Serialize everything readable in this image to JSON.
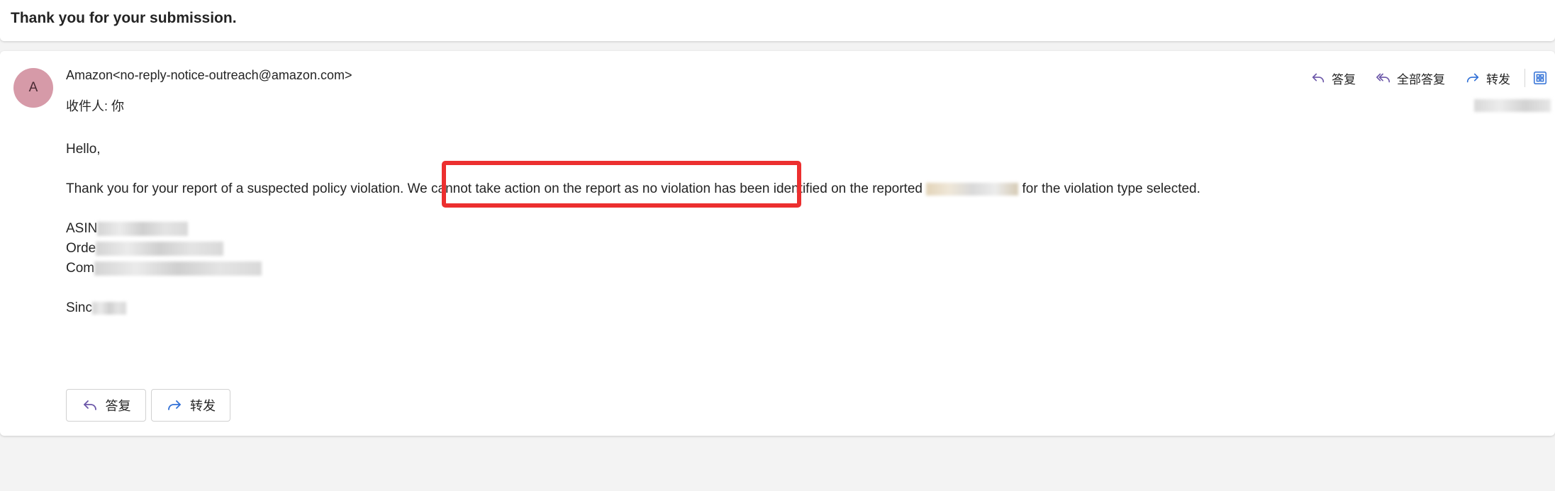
{
  "header": {
    "subject": "Thank you for your submission."
  },
  "message": {
    "avatar_initial": "A",
    "from": "Amazon<no-reply-notice-outreach@amazon.com>",
    "to_label": "收件人:",
    "to_value": "你",
    "actions": {
      "reply": "答复",
      "reply_all": "全部答复",
      "forward": "转发"
    },
    "body": {
      "greeting": "Hello,",
      "line1_pre": "Thank you for your report of a suspected policy violation.",
      "line1_highlight": "We cannot take action on the report as no violation",
      "line1_mid": "has been identified on the reported",
      "line1_post": "for the violation type selected.",
      "asin_prefix": "ASIN",
      "order_prefix": "Orde",
      "comment_prefix": "Com",
      "closing_prefix": "Sinc"
    },
    "footer_buttons": {
      "reply": "答复",
      "forward": "转发"
    }
  },
  "colors": {
    "highlight_border": "#ec2f2f",
    "avatar_bg": "#d69aa8",
    "icon_purple": "#6b56a8",
    "icon_blue": "#2f6fd6"
  },
  "icons": {
    "reply": "reply-arrow-icon",
    "reply_all": "reply-all-arrow-icon",
    "forward": "forward-arrow-icon",
    "view": "grid-view-icon"
  }
}
